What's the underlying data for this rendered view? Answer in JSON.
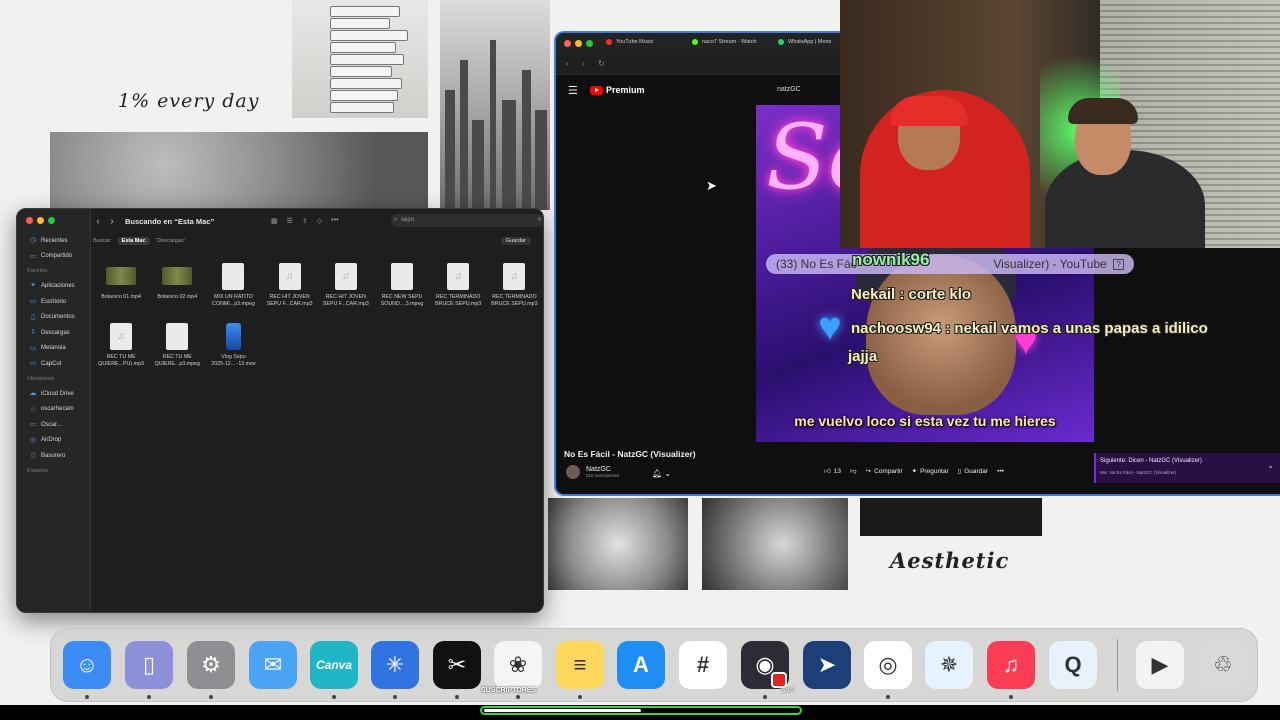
{
  "wallpaper": {
    "caption_top": "1% every day",
    "caption_bottom": "Aesthetic"
  },
  "finder": {
    "title": "Buscando en “Esta Mac”",
    "search_value": "sepu",
    "scope_label": "Buscar:",
    "scope_active": "Esta Mac",
    "scope_other": "“Descargas”",
    "save_label": "Guardar",
    "sidebar": [
      {
        "label": "Recientes",
        "icon": "clock-icon"
      },
      {
        "label": "Compartido",
        "icon": "shared-folder-icon"
      }
    ],
    "favorites_heading": "Favoritos",
    "favorites": [
      {
        "label": "Aplicaciones",
        "icon": "apps-icon"
      },
      {
        "label": "Escritorio",
        "icon": "desktop-icon"
      },
      {
        "label": "Documentos",
        "icon": "document-icon"
      },
      {
        "label": "Descargas",
        "icon": "download-icon"
      },
      {
        "label": "Metanoia",
        "icon": "folder-icon"
      },
      {
        "label": "CapCut",
        "icon": "folder-icon"
      }
    ],
    "locations_heading": "Ubicaciones",
    "locations": [
      {
        "label": "iCloud Drive",
        "icon": "cloud-icon"
      },
      {
        "label": "oscarhecam",
        "icon": "home-icon"
      },
      {
        "label": "Oscar...",
        "icon": "laptop-icon"
      },
      {
        "label": "AirDrop",
        "icon": "airdrop-icon"
      },
      {
        "label": "Basurero",
        "icon": "trash-icon"
      }
    ],
    "tags_heading": "Etiquetas",
    "files": [
      {
        "name": "Botanico 01.mp4",
        "kind": "video"
      },
      {
        "name": "Botanico 02.mp4",
        "kind": "video"
      },
      {
        "name": "MIX UN RATITO\nCONMI...p3.mpeg",
        "kind": "doc"
      },
      {
        "name": "REC HIT JOVEN\nSEPU F...CAR.mp3",
        "kind": "audio"
      },
      {
        "name": "REC HIT JOVEN\nSEPU F...CAR.mp3",
        "kind": "audio"
      },
      {
        "name": "REC NEW SEPU\nSOUND....3.mpeg",
        "kind": "doc"
      },
      {
        "name": "REC TERMINADO\nBRUCE SEPU.mp3",
        "kind": "audio"
      },
      {
        "name": "REC TERMINADO\nBRUCE SEPU.mp3",
        "kind": "audio"
      },
      {
        "name": "REC TU ME\nQUIERE...PU).mp3",
        "kind": "audio"
      },
      {
        "name": "REC TU ME\nQUIERE...p3.mpeg",
        "kind": "doc"
      },
      {
        "name": "Vlog Sepu\n2025-12... -13.mov",
        "kind": "vlog"
      }
    ]
  },
  "browser": {
    "tabs": [
      {
        "label": "YouTube Music",
        "color": "#ff2a2a"
      },
      {
        "label": "naco7 Stream - Watch",
        "color": "#53fc18"
      },
      {
        "label": "WhatsApp | Mens",
        "color": "#25d366"
      }
    ],
    "youtube": {
      "logo_label": "Premium",
      "search_value": "natzGC",
      "video_title": "No Es Fácil - NatzGC (Visualizer)",
      "title_pill": "(33) No Es Fác",
      "title_pill_rest": "Visualizer) - YouTube",
      "subtitle": "me vuelvo loco si esta vez tu me hieres",
      "neon_text": "Se",
      "channel_name": "NatzGC",
      "channel_subs": "510 suscriptores",
      "likes": "13",
      "share_label": "Compartir",
      "ask_label": "Preguntar",
      "save_label": "Guardar",
      "next_title": "Siguiente: Dicen - NatzGC (Visualizer)",
      "next_sub": "Mix: No Es Fácil - NatzGC (Visualizer)"
    }
  },
  "chat": {
    "username": "nownik96",
    "line1": "Nekail : corte klo",
    "line2": "nachoosw94 : nekail vamos a unas papas a idilico",
    "line3": "jajja"
  },
  "dock": {
    "apps": [
      {
        "name": "finder-icon",
        "glyph": "☺",
        "bg": "#3b8df5"
      },
      {
        "name": "iphone-mirroring-icon",
        "glyph": "▯",
        "bg": "#8d8fd8"
      },
      {
        "name": "system-settings-icon",
        "glyph": "⚙",
        "bg": "#8e8e93"
      },
      {
        "name": "mail-icon",
        "glyph": "✉",
        "bg": "#4aa3f5"
      },
      {
        "name": "canva-icon",
        "glyph": "Canva",
        "bg": "#21b5c8"
      },
      {
        "name": "spark-icon",
        "glyph": "✳",
        "bg": "#2f74e0"
      },
      {
        "name": "capcut-icon",
        "glyph": "✂",
        "bg": "#111111"
      },
      {
        "name": "chatgpt-icon",
        "glyph": "❀",
        "bg": "#f5f5f5"
      },
      {
        "name": "notes-icon",
        "glyph": "≡",
        "bg": "#fdd85a"
      },
      {
        "name": "app-store-icon",
        "glyph": "A",
        "bg": "#1e8ef5"
      },
      {
        "name": "slack-icon",
        "glyph": "#",
        "bg": "#ffffff"
      },
      {
        "name": "obs-icon",
        "glyph": "◉",
        "bg": "#2c2c34"
      },
      {
        "name": "telegram-direct-icon",
        "glyph": "➤",
        "bg": "#1d3f7a"
      },
      {
        "name": "chrome-icon",
        "glyph": "◎",
        "bg": "#ffffff"
      },
      {
        "name": "safari-icon",
        "glyph": "✵",
        "bg": "#e6f3ff"
      },
      {
        "name": "music-icon",
        "glyph": "♫",
        "bg": "#fa3c55"
      },
      {
        "name": "quicktime-icon",
        "glyph": "Q",
        "bg": "#e9f2fb"
      },
      {
        "name": "video-file-icon",
        "glyph": "▶",
        "bg": "#f3f3f3"
      },
      {
        "name": "trash-icon",
        "glyph": "♲",
        "bg": "#d9d9d9"
      }
    ],
    "hover_label": "SUSCRIPTORES",
    "rec_counter": "5/10"
  },
  "progress": {
    "fraction": 0.5
  }
}
